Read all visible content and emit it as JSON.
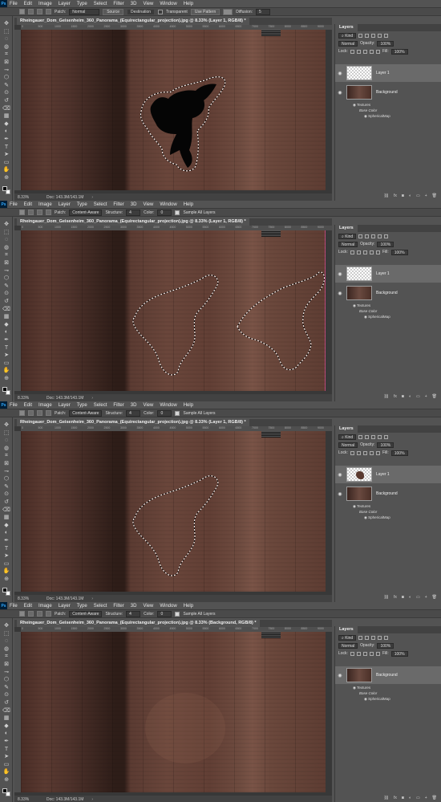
{
  "menus": [
    "File",
    "Edit",
    "Image",
    "Layer",
    "Type",
    "Select",
    "Filter",
    "3D",
    "View",
    "Window",
    "Help"
  ],
  "ps_logo": "Ps",
  "panels": [
    {
      "options": {
        "patch_label": "Patch:",
        "patch_value": "Normal",
        "source_label": "Source",
        "destination_label": "Destination",
        "transparent_label": "Transparent",
        "use_pattern_label": "Use Pattern",
        "diffusion_label": "Diffusion:",
        "diffusion_value": "5"
      },
      "doc_title": "Rheingauer_Dom_Geisenheim_360_Panorama_(Equirectangular_projection).jpg @ 8.33% (Layer 1, RGB/8) *",
      "zoom": "8.33%",
      "doc_size": "Doc: 143.3M/143.1M",
      "layers": {
        "title": "Layers",
        "kind": "Kind",
        "blend": "Normal",
        "opacity_label": "Opacity:",
        "opacity": "100%",
        "lock_label": "Lock:",
        "fill_label": "Fill:",
        "fill": "100%",
        "items": [
          "Layer 1",
          "Background"
        ],
        "textures": "Textures",
        "base_color": "Base Color",
        "spherical_map": "SphericalMap"
      }
    },
    {
      "options": {
        "patch_label": "Patch:",
        "patch_value": "Content-Aware",
        "structure_label": "Structure:",
        "structure_value": "4",
        "color_label": "Color:",
        "color_value": "0",
        "sample_label": "Sample All Layers"
      },
      "doc_title": "Rheingauer_Dom_Geisenheim_360_Panorama_(Equirectangular_projection).jpg @ 8.33% (Layer 1, RGB/8) *",
      "zoom": "8.33%",
      "doc_size": "Doc: 143.3M/143.1M",
      "layers": {
        "title": "Layers",
        "kind": "Kind",
        "blend": "Normal",
        "opacity_label": "Opacity:",
        "opacity": "100%",
        "lock_label": "Lock:",
        "fill_label": "Fill:",
        "fill": "100%",
        "items": [
          "Layer 1",
          "Background"
        ],
        "textures": "Textures",
        "base_color": "Base Color",
        "spherical_map": "SphericalMap"
      }
    },
    {
      "options": {
        "patch_label": "Patch:",
        "patch_value": "Content-Aware",
        "structure_label": "Structure:",
        "structure_value": "4",
        "color_label": "Color:",
        "color_value": "0",
        "sample_label": "Sample All Layers"
      },
      "doc_title": "Rheingauer_Dom_Geisenheim_360_Panorama_(Equirectangular_projection).jpg @ 8.33% (Layer 1, RGB/8) *",
      "zoom": "8.33%",
      "doc_size": "Doc: 143.3M/143.1M",
      "layers": {
        "title": "Layers",
        "kind": "Kind",
        "blend": "Normal",
        "opacity_label": "Opacity:",
        "opacity": "100%",
        "lock_label": "Lock:",
        "fill_label": "Fill:",
        "fill": "100%",
        "items": [
          "Layer 1",
          "Background"
        ],
        "textures": "Textures",
        "base_color": "Base Color",
        "spherical_map": "SphericalMap"
      }
    },
    {
      "options": {
        "patch_label": "Patch:",
        "patch_value": "Content-Aware",
        "structure_label": "Structure:",
        "structure_value": "4",
        "color_label": "Color:",
        "color_value": "0",
        "sample_label": "Sample All Layers"
      },
      "doc_title": "Rheingauer_Dom_Geisenheim_360_Panorama_(Equirectangular_projection).jpg @ 8.33% (Background, RGB/8) *",
      "zoom": "8.33%",
      "doc_size": "Doc: 143.3M/143.1M",
      "layers": {
        "title": "Layers",
        "kind": "Kind",
        "blend": "Normal",
        "opacity_label": "Opacity:",
        "opacity": "100%",
        "lock_label": "Lock:",
        "fill_label": "Fill:",
        "fill": "100%",
        "items": [
          "Background"
        ],
        "textures": "Textures",
        "base_color": "Base Color",
        "spherical_map": "SphericalMap"
      }
    }
  ],
  "ruler_ticks": [
    "0",
    "500",
    "1000",
    "1500",
    "2000",
    "2500",
    "3000",
    "3500",
    "4000",
    "4500",
    "5000",
    "5500",
    "6000",
    "6500",
    "7000",
    "7500",
    "8000",
    "8500",
    "9000"
  ],
  "tool_icons": [
    "move-icon",
    "marquee-icon",
    "lasso-icon",
    "quick-select-icon",
    "crop-icon",
    "frame-icon",
    "eyedropper-icon",
    "patch-icon",
    "brush-icon",
    "clone-stamp-icon",
    "history-brush-icon",
    "eraser-icon",
    "gradient-icon",
    "blur-icon",
    "dodge-icon",
    "pen-icon",
    "type-icon",
    "path-select-icon",
    "rectangle-icon",
    "hand-icon",
    "zoom-icon"
  ],
  "colors": {
    "ui": "#535353",
    "toolbar_dark": "#424242",
    "guide": "#c04a7a",
    "selected_layer": "#6a6a6a"
  }
}
